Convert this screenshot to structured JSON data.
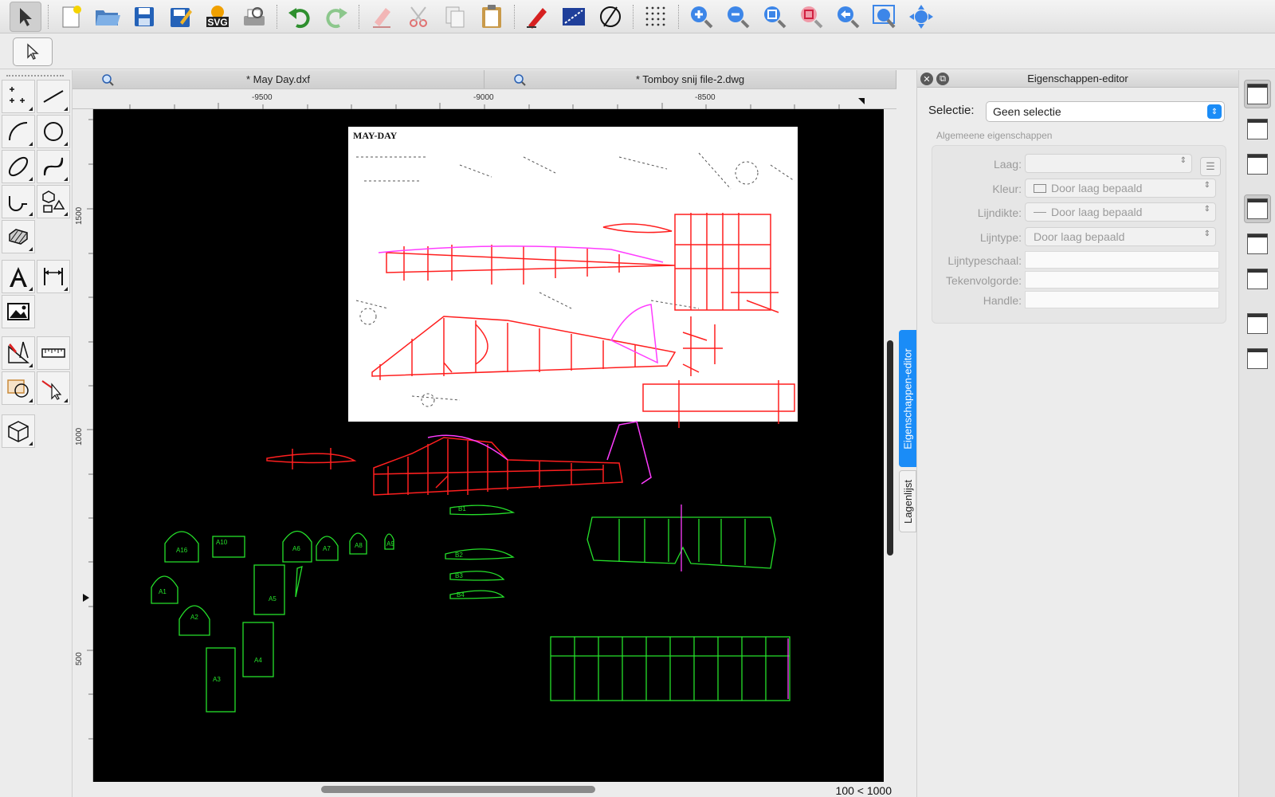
{
  "toolbar": {
    "buttons": [
      "select-tool",
      "new-file",
      "open-file",
      "save-file",
      "save-as",
      "export-svg",
      "print-preview",
      "undo",
      "redo",
      "erase",
      "cut",
      "copy",
      "paste",
      "draw-pen",
      "measure",
      "snap-circle",
      "grid-dots",
      "zoom-in",
      "zoom-out",
      "zoom-auto",
      "zoom-window",
      "zoom-previous",
      "zoom-selection",
      "pan"
    ],
    "svg_label": "SVG"
  },
  "tabs": [
    {
      "label": "* May Day.dxf"
    },
    {
      "label": "* Tomboy  snij file-2.dwg"
    }
  ],
  "ruler": {
    "top": [
      "-9500",
      "-9000",
      "-8500"
    ],
    "left": [
      "1500",
      "1000",
      "500"
    ]
  },
  "canvas": {
    "drawing_title": "MAY-DAY",
    "part_labels": [
      "A16",
      "A10",
      "A6",
      "A7",
      "A8",
      "A9",
      "A1",
      "A2",
      "A5",
      "A4",
      "A3",
      "B1",
      "B2",
      "B3",
      "B4"
    ],
    "coordinate_readout": "100 < 1000"
  },
  "panel": {
    "title": "Eigenschappen-editor",
    "selectie_label": "Selectie:",
    "selectie_value": "Geen selectie",
    "group_title": "Algemeene eigenschappen",
    "rows": [
      {
        "label": "Laag:",
        "value": ""
      },
      {
        "label": "Kleur:",
        "value": "Door laag bepaald"
      },
      {
        "label": "Lijndikte:",
        "value": "Door laag bepaald"
      },
      {
        "label": "Lijntype:",
        "value": "Door laag bepaald"
      },
      {
        "label": "Lijntypeschaal:",
        "value": ""
      },
      {
        "label": "Tekenvolgorde:",
        "value": ""
      },
      {
        "label": "Handle:",
        "value": ""
      }
    ]
  },
  "side_tabs": {
    "active": "Eigenschappen-editor",
    "inactive": "Lagenlijst"
  },
  "colors": {
    "accent": "#1a8cf7",
    "canvas_bg": "#000000",
    "outline_red": "#ff1f1f",
    "outline_magenta": "#ff3cff",
    "outline_green": "#25e02a"
  }
}
